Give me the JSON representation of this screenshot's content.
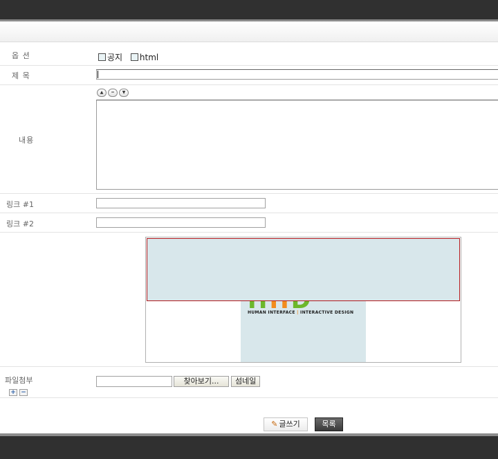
{
  "form": {
    "option": {
      "label": "옵 션",
      "notice": "공지",
      "html": "html"
    },
    "subject": {
      "label": "제 목",
      "value": ""
    },
    "content": {
      "label": "내용",
      "value": "",
      "ctrl_up": "▲",
      "ctrl_mid": "=",
      "ctrl_down": "▼"
    },
    "link1": {
      "label": "링크 #1",
      "value": ""
    },
    "link2": {
      "label": "링크 #2",
      "value": ""
    },
    "preview": {
      "logo_text": "HIID",
      "logo_tag_left": "HUMAN INTERFACE",
      "logo_tag_sep": "|",
      "logo_tag_right": "INTERACTIVE DESIGN"
    },
    "attachment": {
      "label": "파일첨부",
      "browse": "찾아보기...",
      "thumbnail": "섬네일",
      "add": "+",
      "remove": "−"
    }
  },
  "actions": {
    "write": "글쓰기",
    "write_icon": "✎",
    "list": "목록"
  },
  "colors": {
    "bar": "#303030",
    "accent_border": "#b1181c",
    "logo_green": "#6cb82b",
    "logo_orange": "#f28c1e"
  }
}
